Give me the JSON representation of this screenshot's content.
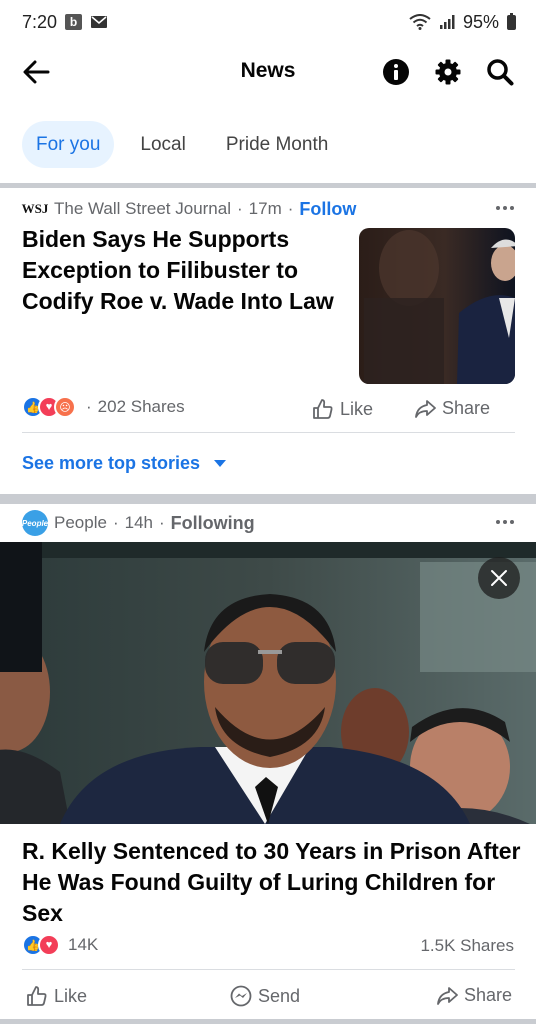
{
  "status_bar": {
    "time": "7:20",
    "b_badge": "b",
    "battery": "95%"
  },
  "nav": {
    "title": "News",
    "icons": [
      "back-arrow-icon",
      "info-icon",
      "gear-icon",
      "search-icon"
    ]
  },
  "tabs": [
    {
      "label": "For you",
      "active": true
    },
    {
      "label": "Local",
      "active": false
    },
    {
      "label": "Pride Month",
      "active": false
    }
  ],
  "post1": {
    "avatar_text": "WSJ",
    "source": "The Wall Street Journal",
    "sep1": "·",
    "time": "17m",
    "sep2": "·",
    "follow": "Follow",
    "headline": "Biden Says He Supports Exception to Filibuster to Codify Roe v. Wade Into Law",
    "reactions": [
      "like",
      "love",
      "angry"
    ],
    "sep3": "·",
    "shares": "202 Shares",
    "like_label": "Like",
    "share_label": "Share",
    "see_more": "See more top stories"
  },
  "post2": {
    "avatar_text": "People",
    "source": "People",
    "sep1": "·",
    "time": "14h",
    "sep2": "·",
    "following": "Following",
    "headline": "R. Kelly Sentenced to 30 Years in Prison After He Was Found Guilty of Luring Children for Sex",
    "reactions": [
      "like",
      "love"
    ],
    "reaction_count": "14K",
    "shares": "1.5K Shares",
    "like_label": "Like",
    "send_label": "Send",
    "share_label": "Share"
  },
  "colors": {
    "accent": "#1b74e4",
    "tab_active_bg": "#e7f3ff",
    "muted": "#65676b",
    "divider": "#c9ccd1"
  }
}
